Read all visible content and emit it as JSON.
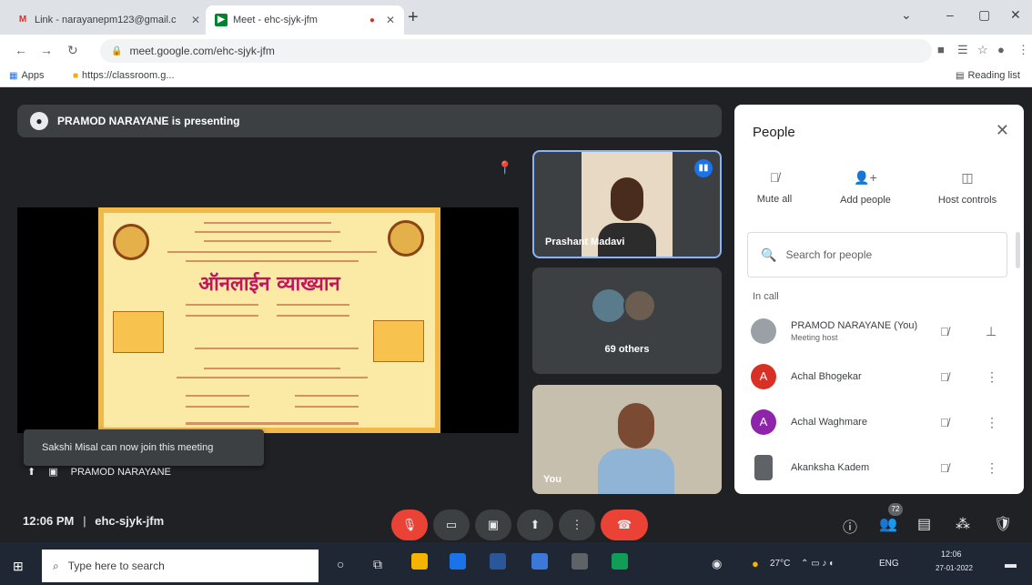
{
  "browser": {
    "tabs": [
      {
        "label": "Link - narayanepm123@gmail.c",
        "icon": "M"
      },
      {
        "label": "Meet - ehc-sjyk-jfm",
        "icon": "meet"
      }
    ],
    "url": "meet.google.com/ehc-sjyk-jfm",
    "bookmarks": [
      {
        "label": "Apps"
      },
      {
        "label": "https://classroom.g..."
      }
    ],
    "reading_list": "Reading list"
  },
  "presentation": {
    "banner": "PRAMOD NARAYANE is presenting",
    "slide_title": "ऑनलाईन व्याख्यान",
    "presenter_label": "PRAMOD NARAYANE",
    "toast": "Sakshi Misal can now join this meeting"
  },
  "tiles": {
    "a_name": "Prashant Madavi",
    "b_others": "69 others",
    "c_name": "You"
  },
  "people": {
    "title": "People",
    "actions": [
      {
        "label": "Mute all",
        "icon": "mic-off-icon"
      },
      {
        "label": "Add people",
        "icon": "add-person-icon"
      },
      {
        "label": "Host controls",
        "icon": "host-controls-icon"
      }
    ],
    "search_placeholder": "Search for people",
    "section": "In call",
    "participants": [
      {
        "name": "PRAMOD NARAYANE (You)",
        "sub": "Meeting host",
        "initial": "",
        "color": "#9aa0a6"
      },
      {
        "name": "Achal Bhogekar",
        "sub": "",
        "initial": "A",
        "color": "#d93025"
      },
      {
        "name": "Achal Waghmare",
        "sub": "",
        "initial": "A",
        "color": "#8e24aa"
      },
      {
        "name": "Akanksha Kadem",
        "sub": "",
        "initial": "",
        "color": "#5f6368"
      }
    ]
  },
  "controls": {
    "time": "12:06 PM",
    "separator": "|",
    "meeting_code": "ehc-sjyk-jfm",
    "participant_count": "72"
  },
  "taskbar": {
    "search_placeholder": "Type here to search",
    "weather": "27°C",
    "lang": "ENG",
    "time": "12:06",
    "date": "27-01-2022"
  }
}
